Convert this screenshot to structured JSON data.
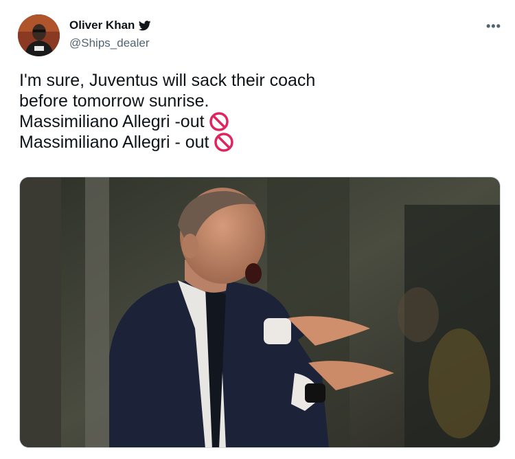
{
  "author": {
    "name": "Oliver Khan",
    "handle": "@Ships_dealer",
    "verified_icon": "twitter-bird-icon"
  },
  "menu": {
    "more_icon": "more-horizontal-icon",
    "label": "•••"
  },
  "tweet": {
    "lines": [
      "I'm sure, Juventus will sack their coach",
      "before tomorrow sunrise.",
      "Massimiliano Allegri -out",
      "Massimiliano Allegri - out"
    ],
    "emoji": "prohibited-icon"
  },
  "media": {
    "type": "photo"
  },
  "colors": {
    "accent": "#1d9bf0",
    "prohibited": "#e0245e",
    "muted": "#536471"
  }
}
